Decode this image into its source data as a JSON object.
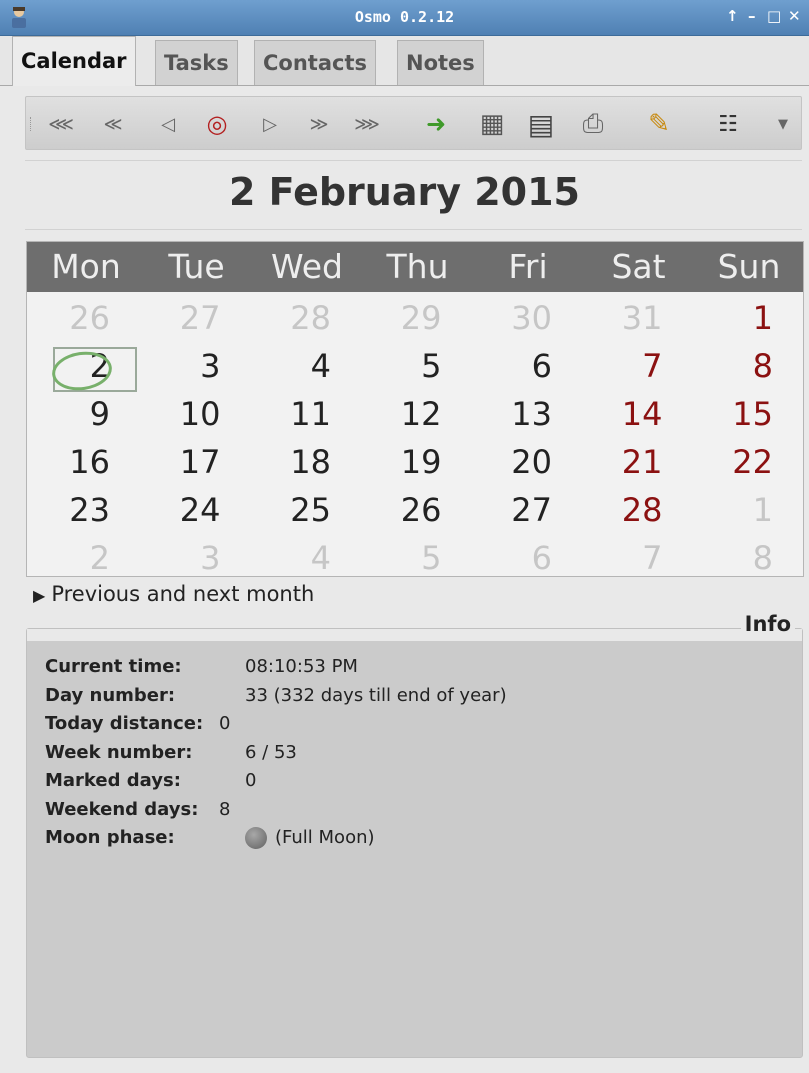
{
  "window": {
    "title": "Osmo 0.2.12",
    "controls": [
      "↑",
      "–",
      "□",
      "✕"
    ]
  },
  "tabs": [
    {
      "label": "Calendar",
      "active": true
    },
    {
      "label": "Tasks",
      "active": false
    },
    {
      "label": "Contacts",
      "active": false
    },
    {
      "label": "Notes",
      "active": false
    }
  ],
  "toolbar": {
    "items": [
      {
        "name": "prev-year-button",
        "glyph": "⋘"
      },
      {
        "name": "prev-month-button",
        "glyph": "≪"
      },
      {
        "name": "prev-day-button",
        "glyph": "◁"
      },
      {
        "name": "today-button",
        "glyph": "◎"
      },
      {
        "name": "next-day-button",
        "glyph": "▷"
      },
      {
        "name": "next-month-button",
        "glyph": "≫"
      },
      {
        "name": "next-year-button",
        "glyph": "⋙"
      },
      {
        "name": "jump-to-date-button",
        "glyph": "➜"
      },
      {
        "name": "full-year-calendar-button",
        "glyph": "▦"
      },
      {
        "name": "date-calculator-button",
        "glyph": "▤"
      },
      {
        "name": "print-button",
        "glyph": "⎙"
      },
      {
        "name": "notes-button",
        "glyph": "✎"
      },
      {
        "name": "preferences-button",
        "glyph": "☷"
      },
      {
        "name": "toolbar-overflow-button",
        "glyph": "▼"
      }
    ]
  },
  "date_header": "2 February 2015",
  "calendar": {
    "day_names": [
      "Mon",
      "Tue",
      "Wed",
      "Thu",
      "Fri",
      "Sat",
      "Sun"
    ],
    "weeks": [
      [
        {
          "d": "26",
          "t": "other"
        },
        {
          "d": "27",
          "t": "other"
        },
        {
          "d": "28",
          "t": "other"
        },
        {
          "d": "29",
          "t": "other"
        },
        {
          "d": "30",
          "t": "other"
        },
        {
          "d": "31",
          "t": "other"
        },
        {
          "d": "1",
          "t": "weekend"
        }
      ],
      [
        {
          "d": "2",
          "t": "normal"
        },
        {
          "d": "3",
          "t": "normal"
        },
        {
          "d": "4",
          "t": "normal"
        },
        {
          "d": "5",
          "t": "normal"
        },
        {
          "d": "6",
          "t": "normal"
        },
        {
          "d": "7",
          "t": "weekend"
        },
        {
          "d": "8",
          "t": "weekend"
        }
      ],
      [
        {
          "d": "9",
          "t": "normal"
        },
        {
          "d": "10",
          "t": "normal"
        },
        {
          "d": "11",
          "t": "normal"
        },
        {
          "d": "12",
          "t": "normal"
        },
        {
          "d": "13",
          "t": "normal"
        },
        {
          "d": "14",
          "t": "weekend"
        },
        {
          "d": "15",
          "t": "weekend"
        }
      ],
      [
        {
          "d": "16",
          "t": "normal"
        },
        {
          "d": "17",
          "t": "normal"
        },
        {
          "d": "18",
          "t": "normal"
        },
        {
          "d": "19",
          "t": "normal"
        },
        {
          "d": "20",
          "t": "normal"
        },
        {
          "d": "21",
          "t": "weekend"
        },
        {
          "d": "22",
          "t": "weekend"
        }
      ],
      [
        {
          "d": "23",
          "t": "normal"
        },
        {
          "d": "24",
          "t": "normal"
        },
        {
          "d": "25",
          "t": "normal"
        },
        {
          "d": "26",
          "t": "normal"
        },
        {
          "d": "27",
          "t": "normal"
        },
        {
          "d": "28",
          "t": "weekend"
        },
        {
          "d": "1",
          "t": "other"
        }
      ],
      [
        {
          "d": "2",
          "t": "other"
        },
        {
          "d": "3",
          "t": "other"
        },
        {
          "d": "4",
          "t": "other"
        },
        {
          "d": "5",
          "t": "other"
        },
        {
          "d": "6",
          "t": "other"
        },
        {
          "d": "7",
          "t": "other"
        },
        {
          "d": "8",
          "t": "other"
        }
      ]
    ],
    "colors": {
      "weekend": "#8b1111",
      "other": "#c6c6c6",
      "header_bg": "#6e6e6e",
      "today_ring": "#78b06b"
    }
  },
  "expander": {
    "label": "Previous and next month"
  },
  "info": {
    "title": "Info",
    "rows": [
      {
        "key": "Current time:",
        "value": "08:10:53 PM"
      },
      {
        "key": "Day number:",
        "value": "33 (332 days till end of year)"
      },
      {
        "key": "Today distance:",
        "value": "0"
      },
      {
        "key": "Week number:",
        "value": "6 / 53"
      },
      {
        "key": "Marked days:",
        "value": "0"
      },
      {
        "key": "Weekend days:",
        "value": "8"
      },
      {
        "key": "Moon phase:",
        "value": "(Full Moon)",
        "icon": "moon-full-icon"
      }
    ]
  }
}
